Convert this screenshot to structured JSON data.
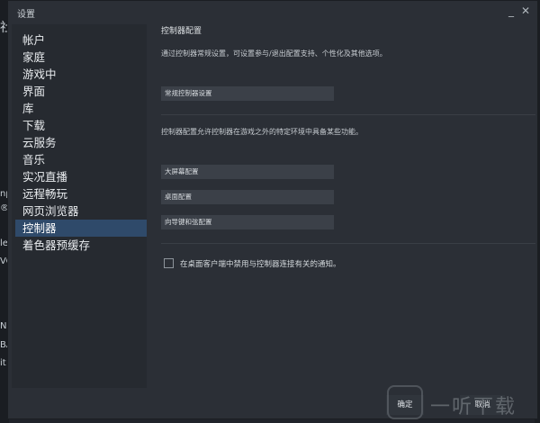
{
  "background": {
    "left_chars": [
      "社",
      "np",
      "®",
      "le",
      "VO",
      "N",
      "BA",
      "it"
    ]
  },
  "window": {
    "title": "设置",
    "minimize_glyph": "_",
    "close_glyph": "✕"
  },
  "sidebar": {
    "items": [
      {
        "label": "帐户"
      },
      {
        "label": "家庭"
      },
      {
        "label": "游戏中"
      },
      {
        "label": "界面"
      },
      {
        "label": "库"
      },
      {
        "label": "下载"
      },
      {
        "label": "云服务"
      },
      {
        "label": "音乐"
      },
      {
        "label": "实况直播"
      },
      {
        "label": "远程畅玩"
      },
      {
        "label": "网页浏览器"
      },
      {
        "label": "控制器",
        "active": true
      },
      {
        "label": "着色器预缓存"
      }
    ]
  },
  "main": {
    "section_title": "控制器配置",
    "desc1": "通过控制器常规设置，可设置参与/退出配置支持、个性化及其他选项。",
    "general_button": "常规控制器设置",
    "desc2": "控制器配置允许控制器在游戏之外的特定环境中具备某些功能。",
    "big_picture_button": "大屏幕配置",
    "desktop_button": "桌面配置",
    "guide_button": "向导键和弦配置",
    "checkbox_label": "在桌面客户端中禁用与控制器连接有关的通知。"
  },
  "footer": {
    "ok_label": "确定",
    "cancel_label": "取消"
  },
  "watermark": {
    "text": "一听下载"
  },
  "colors": {
    "active_item": "#2f4a6a",
    "button_bg": "#3b4048",
    "window_bg": "#2b2f36"
  }
}
